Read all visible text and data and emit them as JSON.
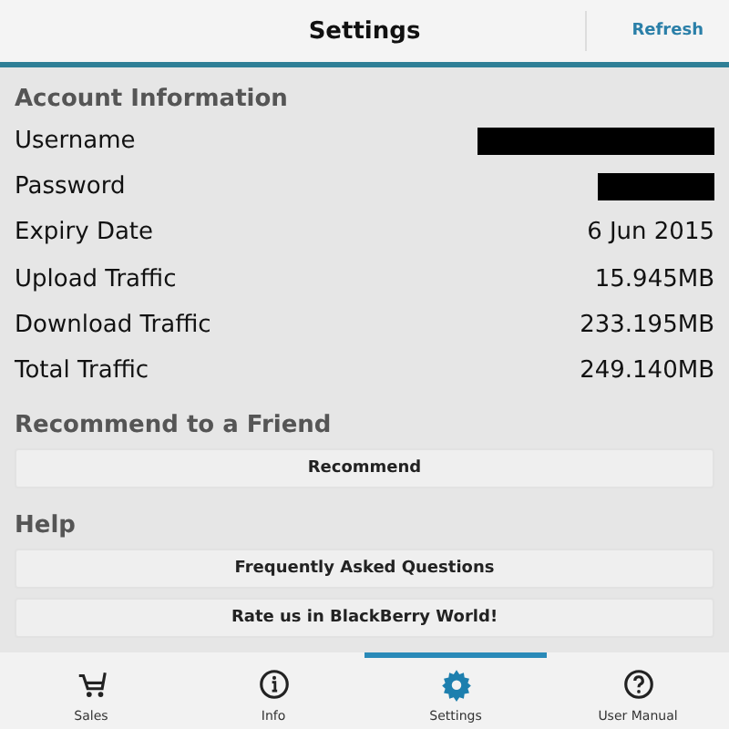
{
  "title_bar": {
    "title": "Settings",
    "action": "Refresh"
  },
  "sections": [
    {
      "heading": "Account Information",
      "rows": [
        {
          "kind": "redacted",
          "label": "Username"
        },
        {
          "kind": "blackout",
          "label": "Password"
        },
        {
          "kind": "text",
          "label": "Expiry Date",
          "value": "6 Jun 2015"
        },
        {
          "kind": "text",
          "label": "Upload Traffic",
          "value": "15.945MB"
        },
        {
          "kind": "text",
          "label": "Download Traffic",
          "value": "233.195MB"
        },
        {
          "kind": "text",
          "label": "Total Traffic",
          "value": "249.140MB"
        }
      ]
    },
    {
      "heading": "Recommend to a Friend",
      "buttons": [
        "Recommend"
      ]
    },
    {
      "heading": "Help",
      "buttons": [
        "Frequently Asked Questions",
        "Rate us in BlackBerry World!"
      ]
    }
  ],
  "tabs": [
    {
      "kind": "cart",
      "label": "Sales",
      "selected": false
    },
    {
      "kind": "info",
      "label": "Info",
      "selected": false
    },
    {
      "kind": "gear",
      "label": "Settings",
      "selected": true
    },
    {
      "kind": "help",
      "label": "User Manual",
      "selected": false
    }
  ]
}
